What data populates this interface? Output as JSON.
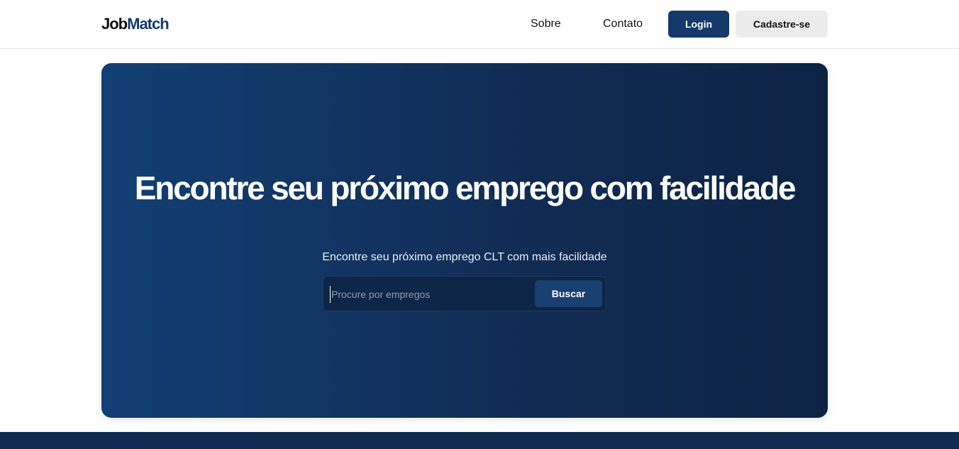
{
  "header": {
    "logo_part1": "Job",
    "logo_part2": "Match",
    "nav": {
      "sobre": "Sobre",
      "contato": "Contato"
    },
    "login_label": "Login",
    "signup_label": "Cadastre-se"
  },
  "hero": {
    "title": "Encontre seu próximo emprego com facilidade",
    "subtitle": "Encontre seu próximo emprego CLT com mais facilidade",
    "search": {
      "placeholder": "Procure por empregos",
      "value": "",
      "button_label": "Buscar"
    }
  },
  "colors": {
    "primary": "#15396b",
    "hero_gradient_start": "#123f74",
    "hero_gradient_end": "#0c2344",
    "footer": "#132b52"
  }
}
